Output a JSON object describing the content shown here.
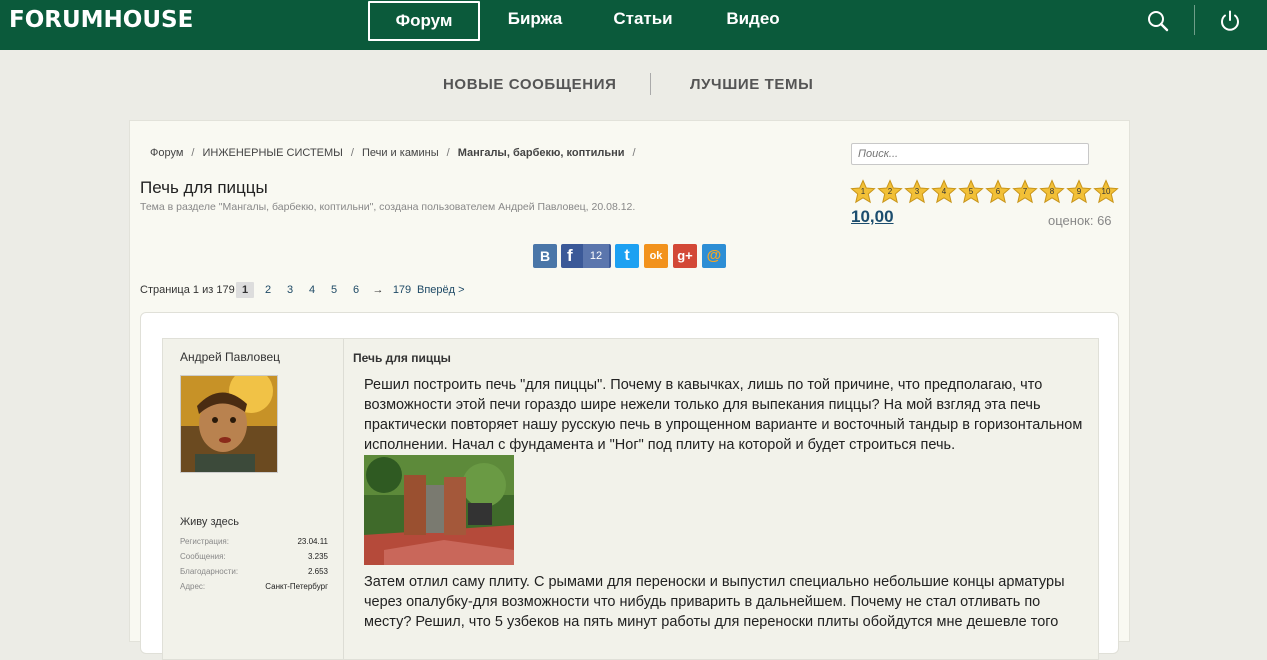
{
  "site": {
    "logo": "FORUMHOUSE"
  },
  "nav": {
    "items": [
      "Форум",
      "Биржа",
      "Статьи",
      "Видео"
    ],
    "active": "Форум"
  },
  "subnav": {
    "new_posts": "НОВЫЕ СООБЩЕНИЯ",
    "best_topics": "ЛУЧШИЕ ТЕМЫ"
  },
  "breadcrumb": [
    "Форум",
    "ИНЖЕНЕРНЫЕ СИСТЕМЫ",
    "Печи и камины",
    "Мангалы, барбекю, коптильни"
  ],
  "search": {
    "placeholder": "Поиск..."
  },
  "thread": {
    "title": "Печь для пиццы",
    "subtitle": "Тема в разделе \"Мангалы, барбекю, коптильни\", создана пользователем Андрей Павловец, 20.08.12."
  },
  "rating": {
    "stars": [
      "1",
      "2",
      "3",
      "4",
      "5",
      "6",
      "7",
      "8",
      "9",
      "10"
    ],
    "value": "10,00",
    "votes": "оценок: 66"
  },
  "share": {
    "vk": "В",
    "fb": "f",
    "fb_count": "12",
    "tw": "t",
    "ok": "ok",
    "gplus": "g+",
    "mail": "@"
  },
  "pager": {
    "label": "Страница 1 из 179",
    "pages": [
      "1",
      "2",
      "3",
      "4",
      "5",
      "6"
    ],
    "arrow": "→",
    "last": "179",
    "next": "Вперёд >"
  },
  "post": {
    "author": "Андрей Павловец",
    "status": "Живу здесь",
    "stats": [
      {
        "k": "Регистрация:",
        "v": "23.04.11"
      },
      {
        "k": "Сообщения:",
        "v": "3.235"
      },
      {
        "k": "Благодарности:",
        "v": "2.653"
      },
      {
        "k": "Адрес:",
        "v": "Санкт-Петербург"
      }
    ],
    "title": "Печь для пиццы",
    "para1": "Решил построить печь \"для пиццы\". Почему в кавычках, лишь по той причине, что предполагаю, что возможности этой печи гораздо шире нежели только для выпекания пиццы? На мой взгляд эта печь практически повторяет нашу русскую печь в упрощенном варианте и восточный тандыр в горизонтальном исполнении. Начал с фундамента и \"Ног\" под плиту на которой и будет строиться печь.",
    "para2": "Затем отлил саму плиту. С рымами для переноски и выпустил специально небольшие концы арматуры через опалубку-для возможности что нибудь приварить в дальнейшем. Почему не стал отливать по месту? Решил, что 5 узбеков на пять минут работы для переноски плиты обойдутся мне дешевле того"
  },
  "colors": {
    "topbar": "#0b5a3b",
    "link": "#1c4d6e",
    "star": "#f2c037"
  }
}
